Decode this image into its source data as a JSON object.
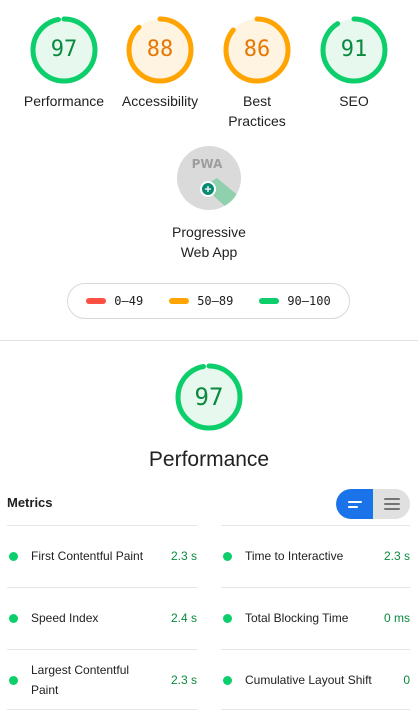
{
  "colors": {
    "pass": "#0cce6b",
    "pass_text": "#0a8a3e",
    "pass_fill": "#e7f8ee",
    "average": "#ffa400",
    "average_text": "#e67700",
    "average_fill": "#fff3e2",
    "fail": "#ff4e42",
    "toggle_active": "#1a73e8"
  },
  "categories": [
    {
      "score": "97",
      "label": "Performance",
      "level": "pass",
      "fraction": 0.97
    },
    {
      "score": "88",
      "label": "Accessibility",
      "level": "average",
      "fraction": 0.88
    },
    {
      "score": "86",
      "label": "Best Practices",
      "level": "average",
      "fraction": 0.86
    },
    {
      "score": "91",
      "label": "SEO",
      "level": "pass",
      "fraction": 0.91
    }
  ],
  "pwa": {
    "label": "Progressive Web App",
    "badge_text": "PWA",
    "badge_icon": "pwa-badge-icon"
  },
  "legend": [
    {
      "range": "0–49",
      "level": "fail"
    },
    {
      "range": "50–89",
      "level": "average"
    },
    {
      "range": "90–100",
      "level": "pass"
    }
  ],
  "performance": {
    "score": "97",
    "title": "Performance",
    "fraction": 0.97
  },
  "metrics": {
    "header": "Metrics",
    "view_toggle": {
      "active": "compact-view-icon",
      "inactive": "expanded-view-icon"
    },
    "items": [
      {
        "name": "First Contentful Paint",
        "value": "2.3 s"
      },
      {
        "name": "Time to Interactive",
        "value": "2.3 s"
      },
      {
        "name": "Speed Index",
        "value": "2.4 s"
      },
      {
        "name": "Total Blocking Time",
        "value": "0 ms"
      },
      {
        "name": "Largest Contentful Paint",
        "value": "2.3 s"
      },
      {
        "name": "Cumulative Layout Shift",
        "value": "0"
      }
    ]
  }
}
